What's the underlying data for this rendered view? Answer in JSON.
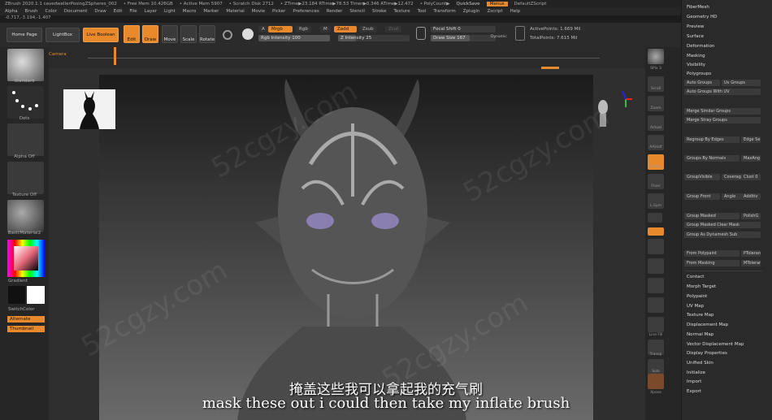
{
  "titlebar": {
    "items": [
      "ZBrush 2020.1.1 cavedwellerPosingZSpheres_002",
      "• Free Mem 10.426GB",
      "• Active Mem 5907",
      "• Scratch Disk 2712",
      "• ZTime▶23.184 RTime▶78.53 Timer▶0.346 ATime▶12.472",
      "• PolyCount▶"
    ],
    "quicksave": "QuickSave",
    "menus": "Menus",
    "defaultscript": "DefaultZScript"
  },
  "menubar": [
    "Alpha",
    "Brush",
    "Color",
    "Document",
    "Draw",
    "Edit",
    "File",
    "Layer",
    "Light",
    "Macro",
    "Marker",
    "Material",
    "Movie",
    "Picker",
    "Preferences",
    "Render",
    "Stencil",
    "Stroke",
    "Texture",
    "Tool",
    "Transform",
    "Zplugin",
    "Zscript",
    "Help"
  ],
  "coords": "-0.717,-3.194,-1.407",
  "shelf": {
    "home_page": "Home Page",
    "lightbox": "LightBox",
    "live_boolean": "Live Boolean",
    "edit": "Edit",
    "draw": "Draw",
    "move": "Move",
    "scale": "Scale",
    "rotate": "Rotate",
    "a_label": "A",
    "mrgb": "Mrgb",
    "rgb": "Rgb",
    "m": "M",
    "zadd": "Zadd",
    "zsub": "Zsub",
    "zcut": "Zcut",
    "rgb_intensity": "Rgb Intensity 100",
    "z_intensity": "Z Intensity 25",
    "focal_shift": "Focal Shift 0",
    "draw_size": "Draw Size 167",
    "dynamic": "Dynamic",
    "active_points": "ActivePoints: 1.669 Mil",
    "total_points": "TotalPoints: 7.615 Mil"
  },
  "timeline": {
    "label": "Camera"
  },
  "lefttray": {
    "standard": "Standard",
    "dots": "Dots",
    "alpha_off": "Alpha Off",
    "texture_off": "Texture Off",
    "material": "BasicMaterial2",
    "gradient": "Gradient",
    "switchcolor": "SwitchColor",
    "alternate": "Alternate",
    "thumbnail": "Thumbnail"
  },
  "rightshelf": [
    "SPix 3",
    "Scroll",
    "Zoom",
    "Actual",
    "AAHalf",
    "Persp",
    "Floor",
    "L.Sym",
    "Frame",
    "Move",
    "Scale",
    "Rotate",
    "Line Fill",
    "Transp",
    "Solo",
    "Xpose"
  ],
  "palette": {
    "top_items": [
      "FiberMesh",
      "Geometry HD",
      "Preview",
      "Surface",
      "Deformation",
      "Masking",
      "Visibility",
      "Polygroups"
    ],
    "polygroups": {
      "auto_groups": "Auto Groups",
      "uv_groups": "Uv Groups",
      "auto_groups_uv": "Auto Groups With UV",
      "merge_similar": "Merge Similar Groups",
      "merge_stray": "Merge Stray Groups",
      "regroup_edges": "Regroup By Edges",
      "edge_se": "Edge Se",
      "groups_by_normals": "Groups By Normals",
      "maxang": "MaxAng",
      "group_visible": "GroupVisible",
      "coverage": "Coverag",
      "clust": "Clust 0",
      "group_front": "Group Front",
      "angle": "Angle",
      "additive": "Additiv",
      "group_masked": "Group Masked",
      "polish_g": "PolishG",
      "group_masked_clear": "Group Masked Clear Mask",
      "group_as_dynamesh": "Group As Dynamesh Sub",
      "from_polypaint": "From Polypaint",
      "ptoler": "PToleran",
      "from_masking": "From Masking",
      "mtoler": "MToleran"
    },
    "bottom_items": [
      "Contact",
      "Morph Target",
      "Polypaint",
      "UV Map",
      "Texture Map",
      "Displacement Map",
      "Normal Map",
      "Vector Displacement Map",
      "Display Properties",
      "Unified Skin",
      "Initialize",
      "Import",
      "Export"
    ]
  },
  "subtitles": {
    "cn": "掩盖这些我可以拿起我的充气刷",
    "en": "mask these out i could then take my inflate brush"
  },
  "watermark": "52cgzy.com",
  "colors": {
    "accent": "#e8892b",
    "bg": "#1c1c1c"
  }
}
